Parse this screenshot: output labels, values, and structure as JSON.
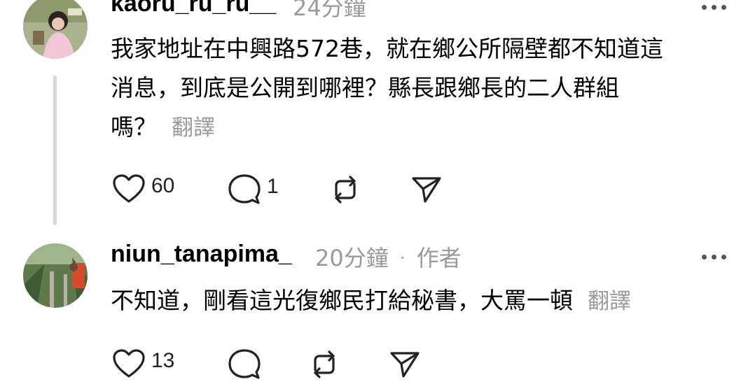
{
  "comments": [
    {
      "username": "kaoru_ru_ru__",
      "time": "24分鐘",
      "author_tag": "",
      "text_lines": [
        "我家地址在中興路572巷，就在鄉公所隔壁都不知道這",
        "消息，到底是公開到哪裡？縣長跟鄉長的二人群組",
        "嗎？"
      ],
      "translate_label": "翻譯",
      "likes": "60",
      "replies": "1",
      "reposts": "",
      "icons": [
        "heart-icon",
        "comment-icon",
        "repost-icon",
        "send-icon",
        "more-icon"
      ]
    },
    {
      "username": "niun_tanapima_",
      "time": "20分鐘",
      "separator": "·",
      "author_tag": "作者",
      "text_lines": [
        "不知道，剛看這光復鄉民打給秘書，大罵一頓"
      ],
      "translate_label": "翻譯",
      "likes": "13",
      "replies": "",
      "reposts": "",
      "icons": [
        "heart-icon",
        "comment-icon",
        "repost-icon",
        "send-icon",
        "more-icon"
      ]
    }
  ],
  "colors": {
    "text": "#000000",
    "muted": "#9a9a9a",
    "thread_line": "#d9d9d9",
    "icon": "#222222"
  }
}
